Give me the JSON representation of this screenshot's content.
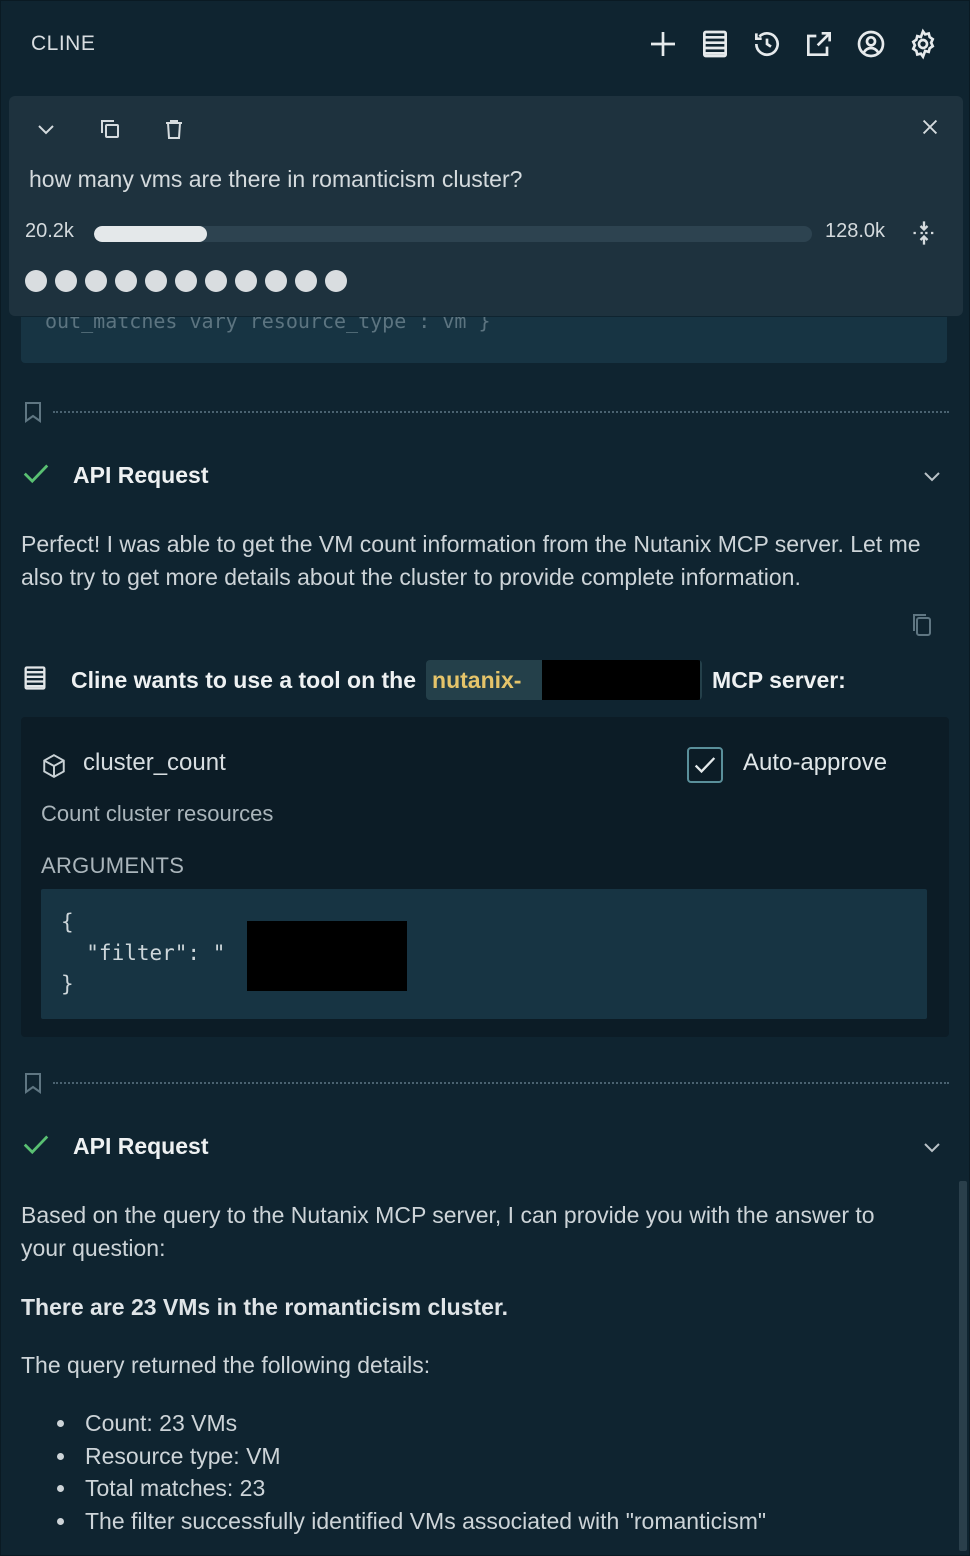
{
  "header": {
    "title": "CLINE",
    "icons": [
      "plus-icon",
      "server-icon",
      "history-icon",
      "popout-icon",
      "account-icon",
      "gear-icon"
    ]
  },
  "task": {
    "question": "how many vms are there in romanticism cluster?",
    "context_used": "20.2k",
    "context_max": "128.0k",
    "context_fraction": 0.158,
    "checkpoint_dots": 11
  },
  "checkpoint_icon": "bookmark-icon",
  "api_request_1": {
    "label": "API Request",
    "status": "success"
  },
  "message_1": "Perfect! I was able to get the VM count information from the Nutanix MCP server. Let me also try to get more details about the cluster to provide complete information.",
  "tool_use": {
    "prefix": "Cline wants to use a tool on the",
    "server_name": "nutanix-",
    "suffix": "MCP server:",
    "tool_name": "cluster_count",
    "auto_approve_label": "Auto-approve",
    "auto_approve_checked": true,
    "description": "Count cluster resources",
    "arguments_label": "ARGUMENTS",
    "arguments_open": "{",
    "arguments_key": "  \"filter\": \"",
    "arguments_value_end": "\"",
    "arguments_close": "}"
  },
  "api_request_2": {
    "label": "API Request",
    "status": "success"
  },
  "message_2": {
    "intro": "Based on the query to the Nutanix MCP server, I can provide you with the answer to your question:",
    "bold": "There are 23 VMs in the romanticism cluster.",
    "details_intro": "The query returned the following details:",
    "items": [
      "Count: 23 VMs",
      "Resource type: VM",
      "Total matches: 23",
      "The filter successfully identified VMs associated with \"romanticism\""
    ]
  }
}
